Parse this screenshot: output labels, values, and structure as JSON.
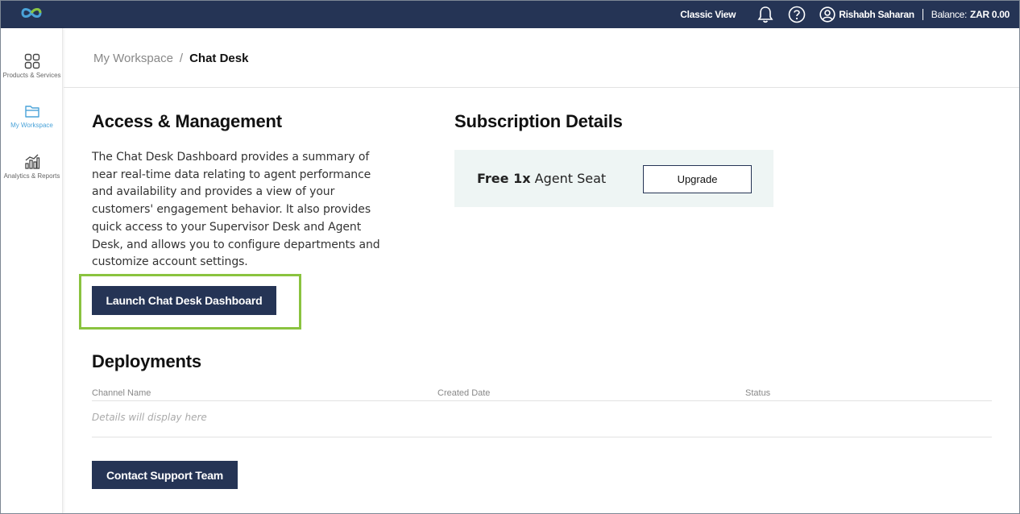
{
  "topbar": {
    "classic_view": "Classic View",
    "user_name": "Rishabh Saharan",
    "balance_label": "Balance:",
    "balance_value": "ZAR 0.00",
    "bg_color": "#253455",
    "logo_color": "#4aa3d9"
  },
  "sidebar": {
    "items": [
      {
        "label": "Products & Services",
        "icon": "grid-icon",
        "active": false
      },
      {
        "label": "My Workspace",
        "icon": "folder-icon",
        "active": true
      },
      {
        "label": "Analytics & Reports",
        "icon": "bar-chart-icon",
        "active": false
      }
    ],
    "active_color": "#4aa3d9"
  },
  "breadcrumb": {
    "parent": "My Workspace",
    "separator": "/",
    "current": "Chat Desk"
  },
  "access": {
    "title": "Access & Management",
    "description": "The Chat Desk Dashboard provides a summary of near real-time data relating to agent performance and availability and provides a view of your customers' engagement behavior. It also provides quick access to your Supervisor Desk and Agent Desk, and allows you to configure departments and customize account settings.",
    "launch_label": "Launch Chat Desk Dashboard",
    "highlight_color": "#8ac33f"
  },
  "subscription": {
    "title": "Subscription Details",
    "seat_bold": "Free 1x",
    "seat_text": "Agent Seat",
    "upgrade_label": "Upgrade"
  },
  "deployments": {
    "title": "Deployments",
    "columns": [
      "Channel Name",
      "Created Date",
      "Status"
    ],
    "empty_text": "Details will display here"
  },
  "contact_label": "Contact Support Team"
}
